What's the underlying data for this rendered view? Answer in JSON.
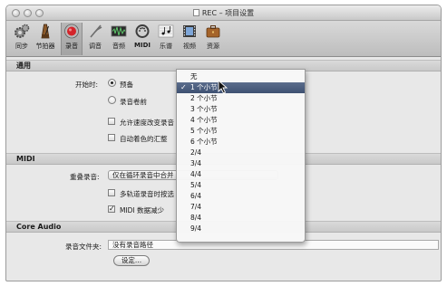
{
  "window": {
    "title": "REC – 项目设置"
  },
  "toolbar": {
    "items": [
      {
        "label": "同步",
        "icon": "gears-icon"
      },
      {
        "label": "节拍器",
        "icon": "metronome-icon"
      },
      {
        "label": "录音",
        "icon": "record-icon",
        "active": true
      },
      {
        "label": "调音",
        "icon": "tuning-fork-icon"
      },
      {
        "label": "音频",
        "icon": "audio-waveform-icon"
      },
      {
        "label": "MIDI",
        "icon": "midi-connector-icon"
      },
      {
        "label": "乐谱",
        "icon": "score-notes-icon"
      },
      {
        "label": "视频",
        "icon": "film-icon"
      },
      {
        "label": "资源",
        "icon": "briefcase-icon"
      }
    ]
  },
  "general": {
    "header": "通用",
    "start_label": "开始时:",
    "radio_count_in": "预备",
    "radio_pre_roll": "录音卷前",
    "check_tempo": "允许速度改变录音",
    "check_auto_color": "自动着色的汇整"
  },
  "midi": {
    "header": "MIDI",
    "overlap_label": "重叠录音:",
    "overlap_value": "仅在循环录音中合并",
    "check_multitrack": "多轨道录音时按选",
    "check_midi_reduce": "MIDI 数据减少"
  },
  "core_audio": {
    "header": "Core Audio",
    "folder_label": "录音文件夹:",
    "folder_value": "没有录音路径",
    "set_button": "设定..."
  },
  "dropdown": {
    "items": [
      "无",
      "1 个小节",
      "2 个小节",
      "3 个小节",
      "4 个小节",
      "5 个小节",
      "6 个小节",
      "2/4",
      "3/4",
      "4/4",
      "5/4",
      "6/4",
      "7/4",
      "8/4",
      "9/4"
    ],
    "selected_index": 1,
    "check_mark": "✓"
  },
  "colors": {
    "selection": "#4a5c7c",
    "record_red": "#d4242a"
  }
}
